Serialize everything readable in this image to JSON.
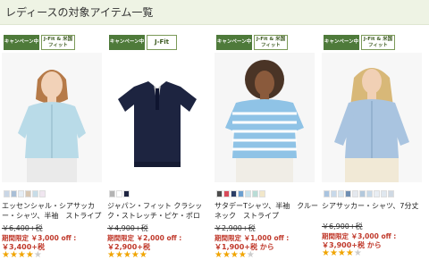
{
  "header": {
    "title": "レディースの対象アイテム一覧"
  },
  "badges": {
    "campaign": "キャンペーン中",
    "jfit_us": "J-Fit & 米国フィット",
    "jfit": "J-Fit"
  },
  "products": [
    {
      "name_lines": [
        "エッセンシャル・シアサッカ",
        "ー・シャツ、半袖　ストライプ"
      ],
      "original_price": "￥6,400+税",
      "promo_text": "期間限定 ￥3,000 off :",
      "sale_price": "￥3,400+税",
      "rating": 4,
      "swatches": [
        "#c9d6e6",
        "#a9bfd6",
        "#e6eef6",
        "#d8c7b3",
        "#c7dde8",
        "#f0e6f0"
      ]
    },
    {
      "name_lines": [
        "ジャパン・フィット クラシッ",
        "ク・ストレッチ・ピケ・ポロ"
      ],
      "original_price": "￥4,900+税",
      "promo_text": "期間限定 ￥2,000 off :",
      "sale_price": "￥2,900+税",
      "rating": 5,
      "swatches": [
        "#b4b4b4",
        "#ffffff",
        "#1d2440"
      ]
    },
    {
      "name_lines": [
        "サタデーTシャツ、半袖　クルー",
        "ネック　ストライプ"
      ],
      "original_price": "￥2,900+税",
      "promo_text": "期間限定 ￥1,000 off :",
      "sale_price": "￥1,900+税 から",
      "rating": 4,
      "swatches": [
        "#4c4c4c",
        "#d84a5a",
        "#2c3e66",
        "#6b9fd0",
        "#c9e3ec",
        "#b9dcd6",
        "#f2e7c9"
      ]
    },
    {
      "name_lines": [
        "シアサッカー・シャツ、7分丈"
      ],
      "original_price": "￥6,900+税",
      "promo_text": "期間限定 ￥3,000 off :",
      "sale_price": "￥3,900+税 から",
      "rating": 4,
      "swatches": [
        "#a9c4e0",
        "#c8d9ea",
        "#d7e6f0",
        "#6f8fb3",
        "#e4e8ee",
        "#b3c8dc",
        "#c7d9e8",
        "#e8edf3",
        "#dfe7ef",
        "#cfd9e4"
      ]
    }
  ],
  "colors": {
    "accent": "#c0392b",
    "header_bg": "#eef3e4",
    "campaign_badge": "#4e7a3a",
    "star": "#f0a400"
  }
}
